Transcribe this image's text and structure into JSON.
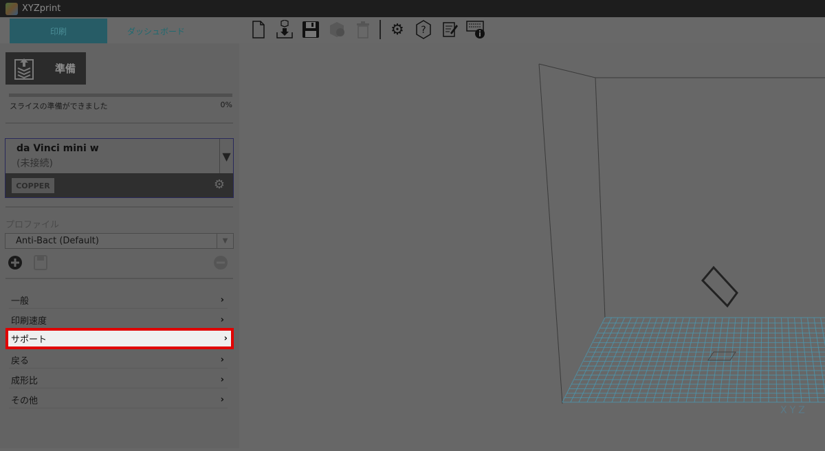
{
  "window": {
    "title": "XYZprint"
  },
  "tabs": [
    {
      "label": "印刷",
      "active": true
    },
    {
      "label": "ダッシュボード",
      "active": false
    }
  ],
  "toolbar": [
    "new-file-icon",
    "import-icon",
    "save-icon",
    "model-repair-icon",
    "trash-icon",
    "settings-icon",
    "help-icon",
    "notes-icon",
    "keyboard-info-icon"
  ],
  "prepare": {
    "label": "準備"
  },
  "slice": {
    "status": "スライスの準備ができました",
    "progress_text": "0%",
    "progress": 0
  },
  "printer": {
    "name": "da Vinci mini w",
    "status": "(未接続)",
    "material": "COPPER"
  },
  "profile": {
    "label": "プロファイル",
    "selected": "Anti-Bact (Default)"
  },
  "menu": [
    {
      "label": "一般"
    },
    {
      "label": "印刷速度"
    },
    {
      "label": "サポート",
      "highlighted": true
    },
    {
      "label": "戻る"
    },
    {
      "label": "成形比"
    },
    {
      "label": "その他"
    }
  ],
  "viewport": {
    "watermark": "XYZ",
    "grid_color": "#4a9ab4",
    "highlight_color": "#e00000"
  }
}
